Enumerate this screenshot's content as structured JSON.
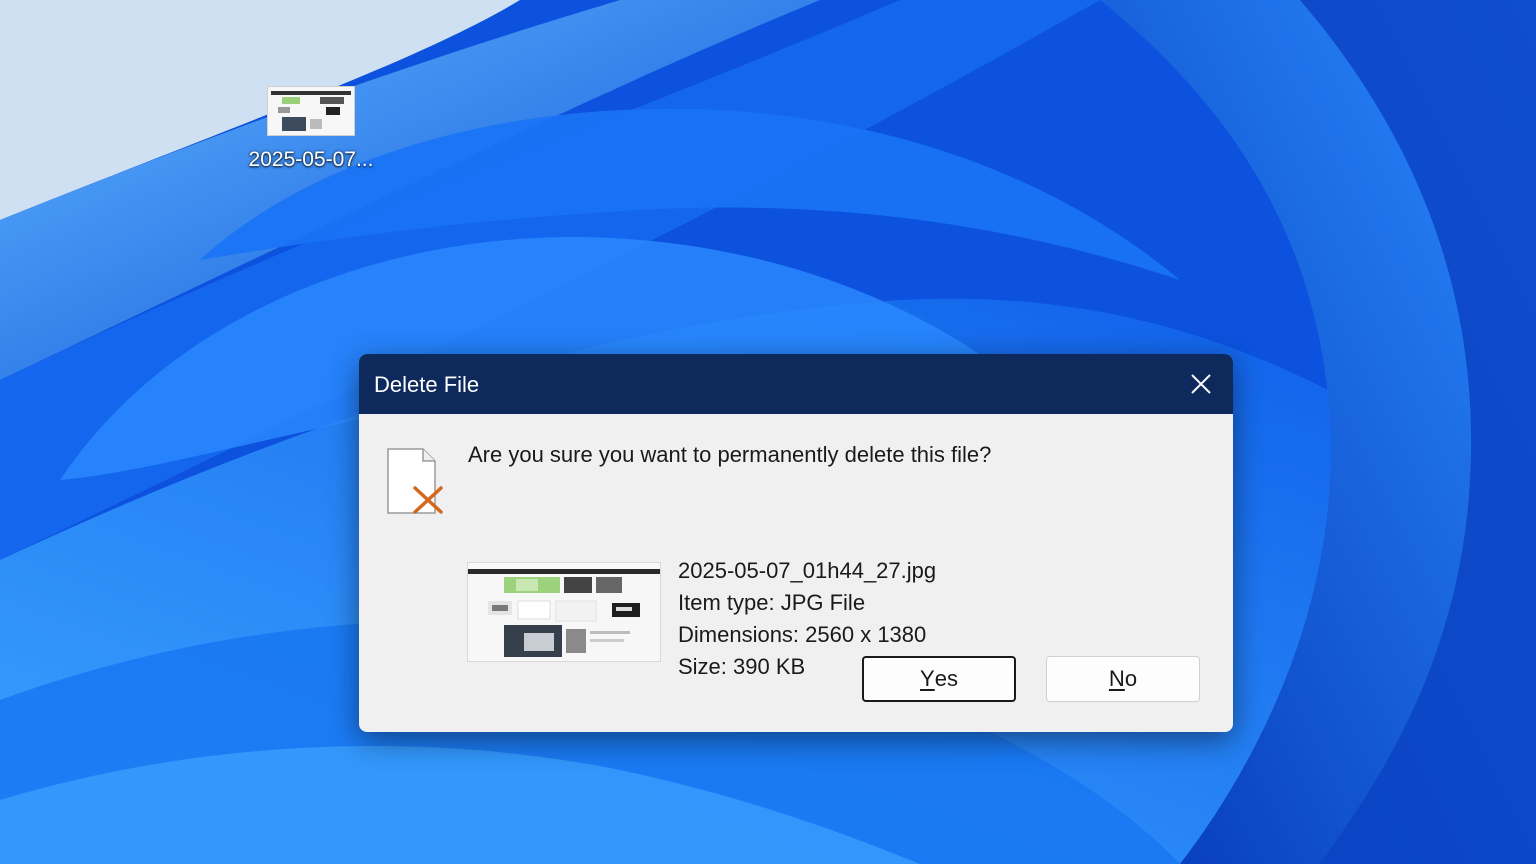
{
  "desktop": {
    "icon_label": "2025-05-07..."
  },
  "dialog": {
    "title": "Delete File",
    "question": "Are you sure you want to permanently delete this file?",
    "file": {
      "name": "2025-05-07_01h44_27.jpg",
      "item_type": "Item type: JPG File",
      "dimensions": "Dimensions: 2560 x 1380",
      "size": "Size: 390 KB"
    },
    "buttons": {
      "yes_mnemonic": "Y",
      "yes_rest": "es",
      "no_mnemonic": "N",
      "no_rest": "o"
    }
  },
  "colors": {
    "titlebar": "#0e2a5c",
    "dialog_bg": "#f0f0f0",
    "wallpaper_accent": "#0f57e0",
    "delete_x": "#d2691e"
  },
  "icons": {
    "close": "close-icon",
    "file_delete": "file-delete-icon",
    "desktop_file": "image-file-icon"
  }
}
